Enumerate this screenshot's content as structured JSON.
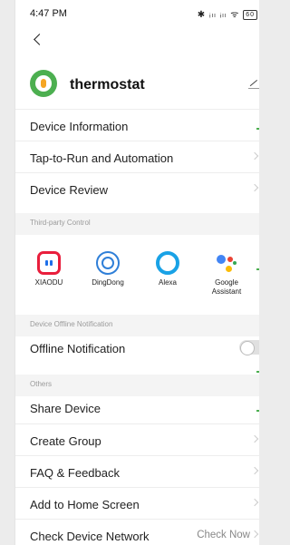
{
  "status_bar": {
    "time": "4:47 PM",
    "signal_icons": "✱ ᵢₗₗ ᵢₗₗ ᯤ",
    "battery": "60"
  },
  "device": {
    "name": "thermostat",
    "icon": "thermostat-icon"
  },
  "menu_top": [
    {
      "label": "Device Information"
    },
    {
      "label": "Tap-to-Run and Automation"
    },
    {
      "label": "Device Review"
    }
  ],
  "third_party": {
    "section_title": "Third-party Control",
    "items": [
      {
        "name": "XIAODU",
        "icon": "xiaodu-icon"
      },
      {
        "name": "DingDong",
        "icon": "dingdong-icon"
      },
      {
        "name": "Alexa",
        "icon": "alexa-icon"
      },
      {
        "name": "Google\nAssistant",
        "icon": "google-assistant-icon"
      }
    ]
  },
  "offline": {
    "section_title": "Device Offline Notification",
    "label": "Offline Notification",
    "enabled": false
  },
  "others": {
    "section_title": "Others",
    "items": [
      {
        "label": "Share Device"
      },
      {
        "label": "Create Group"
      },
      {
        "label": "FAQ & Feedback"
      },
      {
        "label": "Add to Home Screen"
      },
      {
        "label": "Check Device Network",
        "value": "Check Now"
      }
    ]
  },
  "colors": {
    "accent_green": "#4caf50",
    "section_bg": "#f4f4f4"
  }
}
